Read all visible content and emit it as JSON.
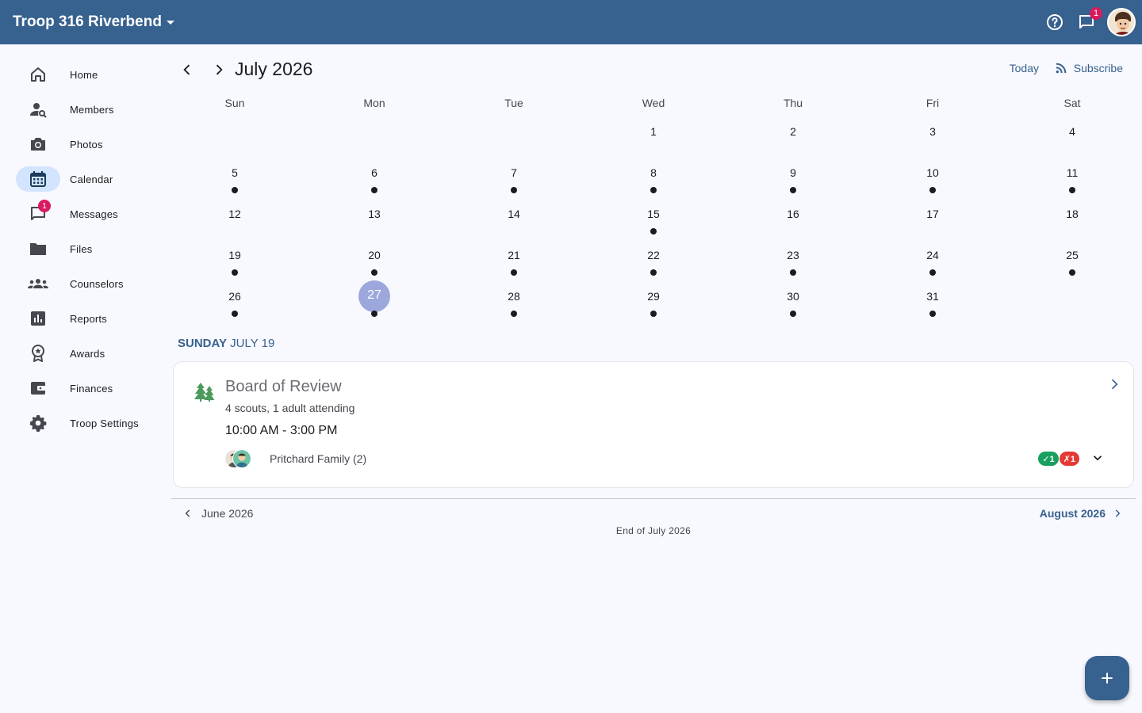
{
  "header": {
    "troop_name": "Troop 316 Riverbend",
    "messages_badge": "1",
    "help_icon": "help-circle-icon",
    "messages_icon": "chat-icon"
  },
  "sidebar": {
    "items": [
      {
        "label": "Home",
        "icon": "home-icon"
      },
      {
        "label": "Members",
        "icon": "person-search-icon"
      },
      {
        "label": "Photos",
        "icon": "camera-icon"
      },
      {
        "label": "Calendar",
        "icon": "calendar-icon",
        "active": true
      },
      {
        "label": "Messages",
        "icon": "chat-icon",
        "badge": "1"
      },
      {
        "label": "Files",
        "icon": "folder-icon"
      },
      {
        "label": "Counselors",
        "icon": "groups-icon"
      },
      {
        "label": "Reports",
        "icon": "bar-chart-icon"
      },
      {
        "label": "Awards",
        "icon": "award-icon"
      },
      {
        "label": "Finances",
        "icon": "wallet-icon"
      },
      {
        "label": "Troop Settings",
        "icon": "gear-icon"
      }
    ]
  },
  "calendar": {
    "month_title": "July 2026",
    "today_label": "Today",
    "subscribe_label": "Subscribe",
    "weekdays": [
      "Sun",
      "Mon",
      "Tue",
      "Wed",
      "Thu",
      "Fri",
      "Sat"
    ],
    "weeks": [
      [
        {
          "d": ""
        },
        {
          "d": ""
        },
        {
          "d": ""
        },
        {
          "d": "1",
          "dot": false
        },
        {
          "d": "2",
          "dot": false
        },
        {
          "d": "3",
          "dot": false
        },
        {
          "d": "4",
          "dot": false
        }
      ],
      [
        {
          "d": "5",
          "dot": true
        },
        {
          "d": "6",
          "dot": true
        },
        {
          "d": "7",
          "dot": true
        },
        {
          "d": "8",
          "dot": true
        },
        {
          "d": "9",
          "dot": true
        },
        {
          "d": "10",
          "dot": true
        },
        {
          "d": "11",
          "dot": true
        }
      ],
      [
        {
          "d": "12",
          "dot": false
        },
        {
          "d": "13",
          "dot": false
        },
        {
          "d": "14",
          "dot": false
        },
        {
          "d": "15",
          "dot": true
        },
        {
          "d": "16",
          "dot": false
        },
        {
          "d": "17",
          "dot": false
        },
        {
          "d": "18",
          "dot": false
        }
      ],
      [
        {
          "d": "19",
          "dot": true
        },
        {
          "d": "20",
          "dot": true
        },
        {
          "d": "21",
          "dot": true
        },
        {
          "d": "22",
          "dot": true
        },
        {
          "d": "23",
          "dot": true
        },
        {
          "d": "24",
          "dot": true
        },
        {
          "d": "25",
          "dot": true
        }
      ],
      [
        {
          "d": "26",
          "dot": true
        },
        {
          "d": "27",
          "dot": true,
          "selected": true
        },
        {
          "d": "28",
          "dot": true
        },
        {
          "d": "29",
          "dot": true
        },
        {
          "d": "30",
          "dot": true
        },
        {
          "d": "31",
          "dot": true
        },
        {
          "d": ""
        }
      ]
    ]
  },
  "selected_day": {
    "dow": "SUNDAY",
    "date": "JULY 19"
  },
  "event": {
    "title": "Board of Review",
    "subtitle": "4 scouts, 1 adult attending",
    "time": "10:00 AM - 3:00 PM",
    "icon": "trees-icon",
    "family": {
      "name": "Pritchard Family (2)",
      "yes_count": "✓1",
      "no_count": "✗1"
    }
  },
  "footer": {
    "prev_month": "June 2026",
    "next_month": "August 2026",
    "end_text": "End of July 2026"
  },
  "colors": {
    "primary": "#37618e",
    "badge": "#d81b60",
    "selected_day": "#9ca7dc",
    "event_icon": "#4c9a5b",
    "rsvp_yes": "#19a05f",
    "rsvp_no": "#e53935"
  }
}
